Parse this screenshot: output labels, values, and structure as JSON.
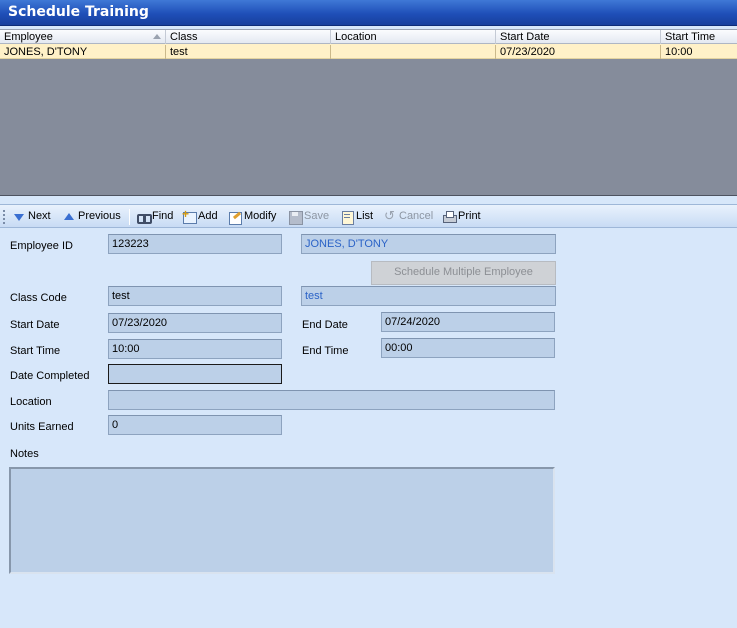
{
  "window": {
    "title": "Schedule Training"
  },
  "grid": {
    "columns": [
      "Employee",
      "Class",
      "Location",
      "Start Date",
      "Start Time"
    ],
    "rows": [
      {
        "employee": "JONES, D'TONY",
        "class": "test",
        "location": "",
        "start_date": "07/23/2020",
        "start_time": "10:00"
      }
    ]
  },
  "toolbar": {
    "next": "Next",
    "previous": "Previous",
    "find": "Find",
    "add": "Add",
    "modify": "Modify",
    "save": "Save",
    "list": "List",
    "cancel": "Cancel",
    "print": "Print"
  },
  "form": {
    "employee_id": {
      "label": "Employee ID",
      "value": "123223"
    },
    "employee_name": "JONES, D'TONY",
    "schedule_multiple_button": "Schedule Multiple Employee",
    "class_code": {
      "label": "Class Code",
      "value": "test",
      "description": "test"
    },
    "start_date": {
      "label": "Start Date",
      "value": "07/23/2020"
    },
    "end_date": {
      "label": "End Date",
      "value": "07/24/2020"
    },
    "start_time": {
      "label": "Start Time",
      "value": "10:00"
    },
    "end_time": {
      "label": "End Time",
      "value": "00:00"
    },
    "date_completed": {
      "label": "Date Completed",
      "value": ""
    },
    "location": {
      "label": "Location",
      "value": ""
    },
    "units_earned": {
      "label": "Units Earned",
      "value": "0"
    },
    "notes": {
      "label": "Notes",
      "value": ""
    }
  },
  "colors": {
    "titlebar": "#1f4fb8",
    "form_background": "#d7e7fa",
    "grid_background": "#858c9b",
    "selected_row": "#fff1c8",
    "field_background": "#bcd0e8",
    "link_text": "#2b63c7"
  }
}
